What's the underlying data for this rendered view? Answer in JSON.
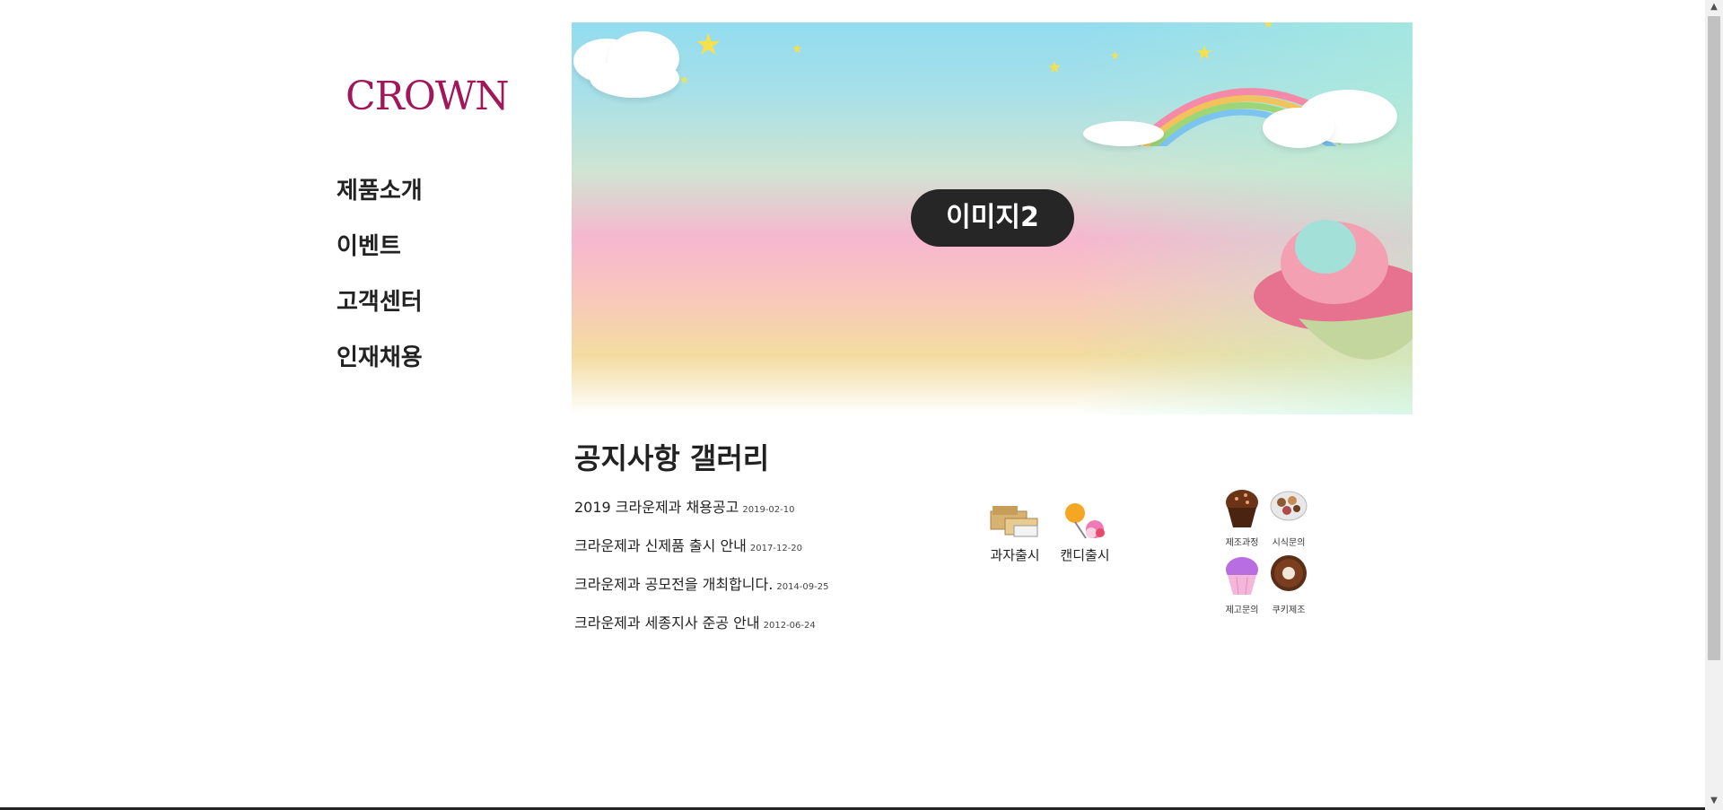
{
  "logo": "CROWN",
  "nav": [
    "제품소개",
    "이벤트",
    "고객센터",
    "인재채용"
  ],
  "hero": {
    "label": "이미지2"
  },
  "section_title": "공지사항 갤러리",
  "notices": [
    {
      "title": "2019 크라운제과 채용공고",
      "date": "2019-02-10"
    },
    {
      "title": "크라운제과 신제품 출시 안내",
      "date": "2017-12-20"
    },
    {
      "title": "크라운제과 공모전을 개최합니다.",
      "date": "2014-09-25"
    },
    {
      "title": "크라운제과 세종지사 준공 안내",
      "date": "2012-06-24"
    }
  ],
  "gallery_main": [
    {
      "caption": "과자출시",
      "icon": "snack-icon"
    },
    {
      "caption": "캔디출시",
      "icon": "candy-icon"
    }
  ],
  "gallery_small": [
    {
      "caption": "제조과정",
      "icon": "chocolate-cupcake-icon"
    },
    {
      "caption": "시식문의",
      "icon": "cookie-plate-icon"
    },
    {
      "caption": "제고문의",
      "icon": "pink-cupcake-icon"
    },
    {
      "caption": "쿠키제조",
      "icon": "donut-icon"
    }
  ]
}
